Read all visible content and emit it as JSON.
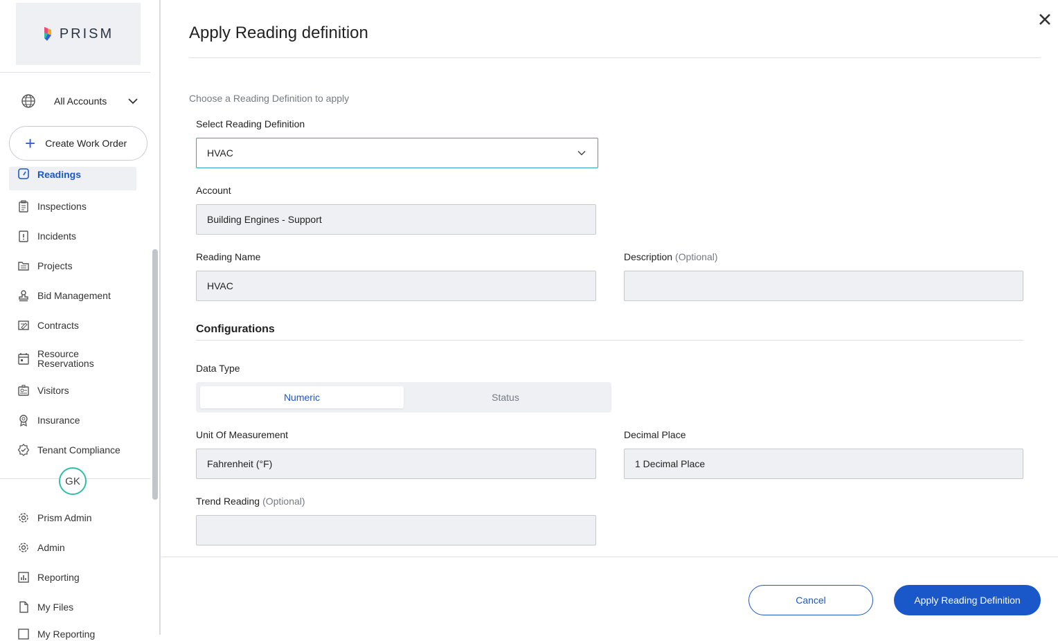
{
  "sidebar": {
    "logo_text": "PRISM",
    "account_selector": "All Accounts",
    "create_button": "Create Work Order",
    "items": [
      {
        "label": "Readings",
        "icon": "gauge-icon"
      },
      {
        "label": "Inspections",
        "icon": "clipboard-icon"
      },
      {
        "label": "Incidents",
        "icon": "alert-clipboard-icon"
      },
      {
        "label": "Projects",
        "icon": "folder-icon"
      },
      {
        "label": "Bid Management",
        "icon": "stamp-icon"
      },
      {
        "label": "Contracts",
        "icon": "contract-icon"
      },
      {
        "label": "Resource\nReservations",
        "icon": "calendar-icon"
      },
      {
        "label": "Visitors",
        "icon": "visitor-badge-icon"
      },
      {
        "label": "Insurance",
        "icon": "ribbon-icon"
      },
      {
        "label": "Tenant Compliance",
        "icon": "check-badge-icon"
      }
    ],
    "avatar_initials": "GK",
    "bottom_items": [
      {
        "label": "Prism Admin",
        "icon": "gear-icon"
      },
      {
        "label": "Admin",
        "icon": "gear-icon"
      },
      {
        "label": "Reporting",
        "icon": "bar-chart-icon"
      },
      {
        "label": "My Files",
        "icon": "file-icon"
      },
      {
        "label": "My Reporting",
        "icon": "report-icon"
      }
    ]
  },
  "modal": {
    "title": "Apply Reading definition",
    "hint": "Choose a Reading Definition to apply",
    "select_label": "Select Reading Definition",
    "select_value": "HVAC",
    "account_label": "Account",
    "account_value": "Building Engines - Support",
    "reading_name_label": "Reading Name",
    "reading_name_value": "HVAC",
    "description_label": "Description",
    "optional_text": "(Optional)",
    "description_value": "",
    "configurations_title": "Configurations",
    "data_type_label": "Data Type",
    "data_type_options": [
      "Numeric",
      "Status"
    ],
    "data_type_selected": "Numeric",
    "unit_label": "Unit Of Measurement",
    "unit_value": "Fahrenheit (°F)",
    "decimal_label": "Decimal Place",
    "decimal_value": "1 Decimal Place",
    "trend_label": "Trend Reading",
    "trend_value": "",
    "cancel_label": "Cancel",
    "apply_label": "Apply Reading Definition"
  },
  "colors": {
    "accent": "#1a57c9",
    "focus_border": "#2ea4c9",
    "field_bg": "#eef0f4",
    "avatar_ring": "#2dbfa5"
  }
}
